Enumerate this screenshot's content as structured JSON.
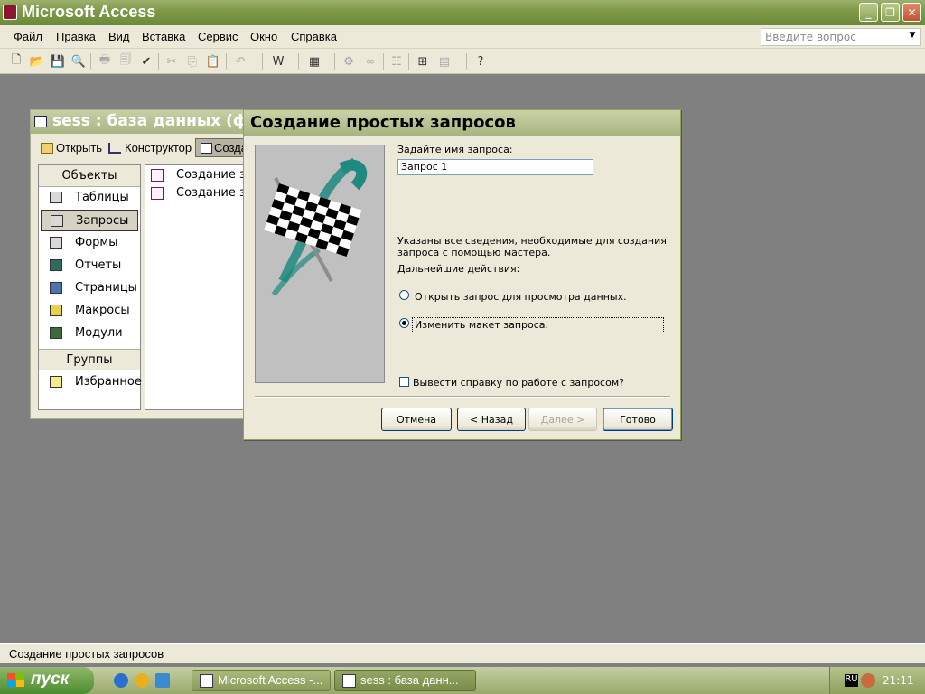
{
  "app": {
    "title": "Microsoft Access",
    "colors": {
      "titlebar": "#7f9b49",
      "desktop": "#808080",
      "face": "#ece9d8"
    }
  },
  "menu": [
    "Файл",
    "Правка",
    "Вид",
    "Вставка",
    "Сервис",
    "Окно",
    "Справка"
  ],
  "help_box": {
    "placeholder": "Введите вопрос"
  },
  "toolbar_icons": [
    "new-icon",
    "open-icon",
    "save-icon",
    "search-icon",
    "print-icon",
    "preview-icon",
    "spell-icon",
    "cut-icon",
    "copy-icon",
    "paste-icon",
    "undo-icon",
    "office-links-icon",
    "analyze-icon",
    "code-icon",
    "script-icon",
    "properties-icon",
    "relationships-icon",
    "new-object-icon",
    "help-icon"
  ],
  "db_window": {
    "title": "sess : база данных (фо",
    "toolbar": {
      "open": "Открыть",
      "design": "Конструктор",
      "create": "Созда"
    },
    "objects_header": "Объекты",
    "objects": [
      {
        "label": "Таблицы",
        "icon": "table-icon",
        "selected": false
      },
      {
        "label": "Запросы",
        "icon": "query-icon",
        "selected": true
      },
      {
        "label": "Формы",
        "icon": "form-icon",
        "selected": false
      },
      {
        "label": "Отчеты",
        "icon": "report-icon",
        "selected": false
      },
      {
        "label": "Страницы",
        "icon": "page-icon",
        "selected": false
      },
      {
        "label": "Макросы",
        "icon": "macro-icon",
        "selected": false
      },
      {
        "label": "Модули",
        "icon": "module-icon",
        "selected": false
      }
    ],
    "groups_header": "Группы",
    "groups": [
      {
        "label": "Избранное",
        "icon": "favorites-icon"
      }
    ],
    "list_items": [
      "Создание за",
      "Создание за"
    ]
  },
  "wizard": {
    "title": "Создание простых запросов",
    "name_label": "Задайте имя запроса:",
    "name_value": "Запрос 1",
    "info_line1": "Указаны все сведения, необходимые для создания",
    "info_line2": "запроса с помощью мастера.",
    "next_actions": "Дальнейшие действия:",
    "options": [
      {
        "label": "Открыть запрос для просмотра данных.",
        "checked": false
      },
      {
        "label": "Изменить макет запроса.",
        "checked": true
      }
    ],
    "help_checkbox": {
      "label": "Вывести справку по работе с запросом?",
      "checked": false
    },
    "buttons": {
      "cancel": "Отмена",
      "back": "< Назад",
      "next": "Далее >",
      "finish": "Готово"
    }
  },
  "status_bar": "Создание простых запросов",
  "taskbar": {
    "start": "пуск",
    "tasks": [
      "Microsoft Access -...",
      "sess : база данн..."
    ],
    "lang": "RU",
    "clock": "21:11"
  }
}
